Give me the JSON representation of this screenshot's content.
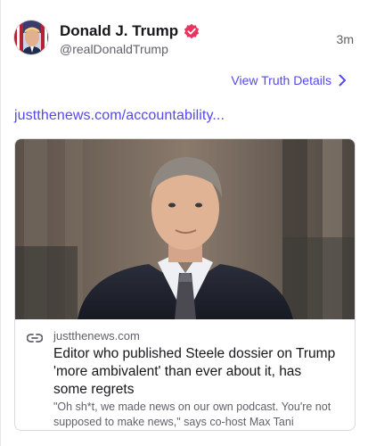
{
  "post": {
    "author": {
      "display_name": "Donald J. Trump",
      "handle": "@realDonaldTrump",
      "verified": true,
      "avatar_icon": "avatar-portrait-flag"
    },
    "timestamp": "3m",
    "view_details_label": "View Truth Details",
    "link_text": "justthenews.com/accountability..."
  },
  "link_card": {
    "image_icon": "portrait-photo",
    "domain": "justthenews.com",
    "title": "Editor who published Steele dossier on Trump 'more ambivalent' than ever about it, has some regrets",
    "description": "\"Oh sh*t, we made news on our own podcast. You're not supposed to make news,\" says co-host Max Tani"
  },
  "colors": {
    "accent": "#5448ee",
    "verified_badge": "#e8355f",
    "muted_text": "#61616b"
  }
}
